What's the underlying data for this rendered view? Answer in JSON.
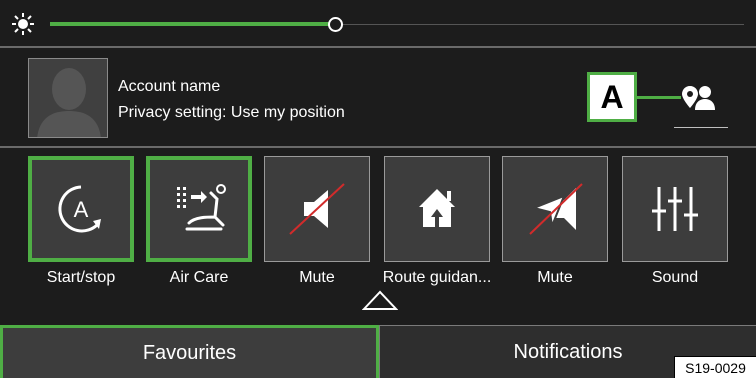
{
  "brightness": {
    "icon": "sun-icon",
    "level": 0.41
  },
  "account": {
    "name": "Account name",
    "privacy": "Privacy setting: Use my position",
    "avatar_icon": "person-silhouette-icon",
    "location_icon": "location-person-icon"
  },
  "callout": {
    "label": "A"
  },
  "tiles": [
    {
      "label": "Start/stop",
      "icon": "auto-start-stop-icon",
      "active": true
    },
    {
      "label": "Air Care",
      "icon": "air-care-seat-icon",
      "active": true
    },
    {
      "label": "Mute",
      "icon": "speaker-muted-icon",
      "active": false
    },
    {
      "label": "Route guidan...",
      "icon": "home-route-icon",
      "active": false
    },
    {
      "label": "Mute",
      "icon": "navigation-voice-muted-icon",
      "active": false
    },
    {
      "label": "Sound",
      "icon": "equalizer-icon",
      "active": false
    }
  ],
  "tabs": {
    "favourites": "Favourites",
    "notifications": "Notifications"
  },
  "code": "S19-0029",
  "colors": {
    "accent": "#4fae45",
    "background": "#1c1c1c",
    "tile": "#3d3d3d",
    "mute_slash": "#d12b2b"
  }
}
